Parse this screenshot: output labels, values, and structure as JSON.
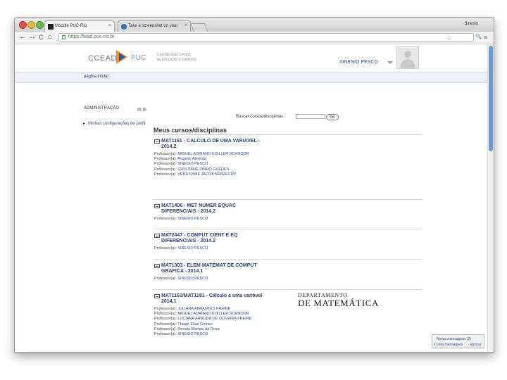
{
  "browser": {
    "tabs": [
      {
        "title": "Moodle PUC-Rio",
        "close": "×"
      },
      {
        "title": "Take a screenshot on your",
        "close": "×"
      }
    ],
    "profile_name": "Sinesio",
    "url_scheme": "https://",
    "url_host": "lead.puc-rio.br",
    "back_glyph": "←",
    "forward_glyph": "→",
    "reload_glyph": "C",
    "home_glyph": "⌂",
    "star_glyph": "☆",
    "search_glyph": "🔍",
    "menu_glyph": "≡"
  },
  "header": {
    "logo_text": "CCEAD",
    "logo_puc": "PUC",
    "logo_sub_line1": "Coordenação Central",
    "logo_sub_line2": "de Educação a Distância",
    "user_name": "SINESIO PESCO"
  },
  "nav": {
    "breadcrumb": "página inicial"
  },
  "admin_block": {
    "title": "ADMINISTRAÇÃO",
    "icons": "▤ ▥",
    "link": "Minhas configurações de perfil"
  },
  "search": {
    "label": "Buscar cursos/disciplinas:",
    "button": "OK"
  },
  "courses_title": "Meus cursos/disciplinas",
  "teacher_label": "Professor(a):",
  "courses": [
    {
      "name": "MAT1161 - CALCULO DE UMA VARIAVEL - 2014.2",
      "teachers": [
        "MIGUEL ADRIANO KOILLER SCHNOOR",
        "Rogerio Almeida",
        "SINESIO PESCO",
        "CRISTIANE PINHO GUEDES",
        "VERA SYME JACOB BENZECRY"
      ]
    },
    {
      "name": "MAT1406 - MET NUMER EQUAC DIFERENCIAIS - 2014.2",
      "teachers": [
        "SINESIO PESCO"
      ]
    },
    {
      "name": "MAT2447 - COMPUT CIENT E EQ DIFERENCIAIS - 2014.2",
      "teachers": [
        "SINESIO PESCO"
      ]
    },
    {
      "name": "MAT1303 - ELEM MATEMAT DE COMPUT GRAFICA - 2014.1",
      "teachers": [
        "SINESIO PESCO"
      ]
    },
    {
      "name": "MAT1161/MAT1181 - Cálculo a uma variável 2014.1",
      "teachers": [
        "JULIANA ABRANTES FREIRE",
        "MIGUEL ADRIANO KOILLER SCHNOOR",
        "LUCIANA ARRUDA DE OLIVEIRA FREIRE",
        "Thiago Elias Gomes",
        "Renata Martins da Rosa",
        "SINESIO PESCO"
      ]
    }
  ],
  "dept": {
    "line1": "DEPARTAMENTO",
    "line2": "DE MATEMÁTICA"
  },
  "messages": {
    "title": "Novas mensagens (2)",
    "link1": "ir para mensagens",
    "link2": "ignorar"
  }
}
